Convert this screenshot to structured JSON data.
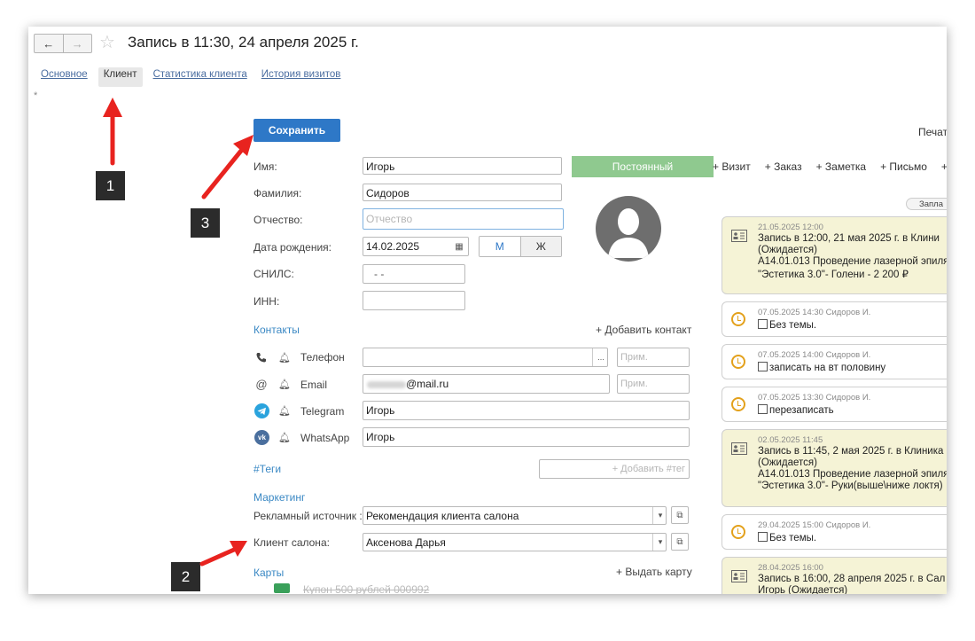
{
  "window": {
    "title": "Запись в 11:30, 24 апреля 2025 г.",
    "back_arrow": "←",
    "forward_arrow": "→",
    "star_glyph": "☆"
  },
  "tabs": [
    {
      "label": "Основное",
      "active": false
    },
    {
      "label": "Клиент",
      "active": true
    },
    {
      "label": "Статистика клиента",
      "active": false
    },
    {
      "label": "История визитов",
      "active": false
    }
  ],
  "asterisk": "*",
  "toolbar": {
    "save_label": "Сохранить",
    "print_label": "Печат"
  },
  "form": {
    "first_name": {
      "label": "Имя:",
      "value": "Игорь"
    },
    "last_name": {
      "label": "Фамилия:",
      "value": "Сидоров"
    },
    "middle_name": {
      "label": "Отчество:",
      "value": "",
      "placeholder": "Отчество"
    },
    "birth_date": {
      "label": "Дата рождения:",
      "value": "14.02.2025"
    },
    "gender": {
      "male": "М",
      "female": "Ж",
      "selected": "М"
    },
    "snils": {
      "label": "СНИЛС:",
      "value": "-  -"
    },
    "inn": {
      "label": "ИНН:",
      "value": ""
    },
    "status_label": "Постоянный"
  },
  "contacts": {
    "section_label": "Контакты",
    "add_label": "+ Добавить контакт",
    "note_placeholder": "Прим.",
    "ellipsis": "...",
    "at_glyph": "@",
    "items": [
      {
        "type": "Телефон",
        "icon": "phone-icon",
        "value": ""
      },
      {
        "type": "Email",
        "icon": "at-icon",
        "value": "@mail.ru"
      },
      {
        "type": "Telegram",
        "icon": "telegram-icon",
        "value": "Игорь"
      },
      {
        "type": "WhatsApp",
        "icon": "vk-icon",
        "value": "Игорь"
      }
    ]
  },
  "tags": {
    "label": "#Теги",
    "add_placeholder": "+ Добавить #тег"
  },
  "marketing": {
    "section_label": "Маркетинг",
    "ad_source": {
      "label": "Рекламный источник :",
      "value": "Рекомендация клиента салона"
    },
    "salon_client": {
      "label": "Клиент салона:",
      "value": "Аксенова Дарья"
    }
  },
  "cards": {
    "section_label": "Карты",
    "issue_label": "+ Выдать карту",
    "coupon": "Купон 500 рублей  000992"
  },
  "actions": [
    "+ Визит",
    "+ Заказ",
    "+ Заметка",
    "+ Письмо"
  ],
  "reminder_toggle": "Запла",
  "timeline": [
    {
      "kind": "visit",
      "meta": "21.05.2025 12:00",
      "lines": [
        "Запись в 12:00, 21 мая 2025 г. в Клини",
        "(Ожидается)",
        "A14.01.013 Проведение лазерной эпиля",
        "\"Эстетика 3.0\"- Голени - 2 200 ₽"
      ]
    },
    {
      "kind": "task",
      "meta": "07.05.2025 14:30 Сидоров И.",
      "lines": [
        "Без темы."
      ]
    },
    {
      "kind": "task",
      "meta": "07.05.2025 14:00 Сидоров И.",
      "lines": [
        "записать на вт половину"
      ]
    },
    {
      "kind": "task",
      "meta": "07.05.2025 13:30 Сидоров И.",
      "lines": [
        "перезаписать"
      ]
    },
    {
      "kind": "visit",
      "meta": "02.05.2025 11:45",
      "lines": [
        "Запись в 11:45, 2 мая 2025 г. в Клиника",
        "(Ожидается)",
        "A14.01.013 Проведение лазерной эпиля",
        "\"Эстетика 3.0\"- Руки(выше\\ниже локтя)"
      ]
    },
    {
      "kind": "task",
      "meta": "29.04.2025 15:00 Сидоров И.",
      "lines": [
        "Без темы."
      ]
    },
    {
      "kind": "visit",
      "meta": "28.04.2025 16:00",
      "lines": [
        "Запись в 16:00, 28 апреля 2025 г. в Сал",
        "Игорь (Ожидается)"
      ]
    }
  ],
  "annotations": {
    "marker_1": "1",
    "marker_2": "2",
    "marker_3": "3",
    "arrow_color": "#e8231f"
  }
}
